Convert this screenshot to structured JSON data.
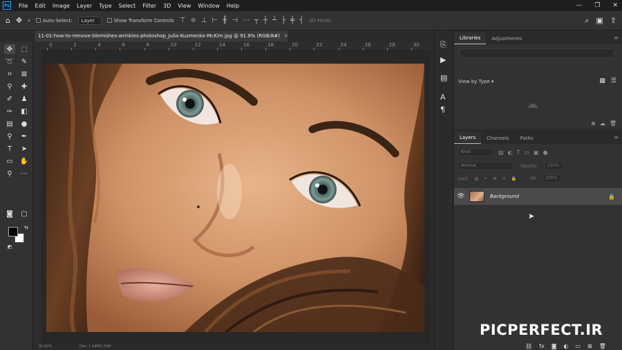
{
  "app": {
    "logo": "Ps"
  },
  "menu": [
    "File",
    "Edit",
    "Image",
    "Layer",
    "Type",
    "Select",
    "Filter",
    "3D",
    "View",
    "Window",
    "Help"
  ],
  "window_controls": [
    "—",
    "❐",
    "✕"
  ],
  "options_bar": {
    "auto_select_label": "Auto-Select:",
    "layer_select_value": "Layer",
    "show_transform_label": "Show Transform Controls",
    "mode_3d_label": "3D Mode:"
  },
  "document": {
    "tab_title": "11-01-how-to-remove-blemishes-wrinkles-photoshop_Julia-Kuzmenko-McKim.jpg @ 91.9% (RGB/8#)",
    "ruler_numbers": [
      "0",
      "2",
      "4",
      "6",
      "8",
      "10",
      "12",
      "14",
      "16",
      "18",
      "20",
      "22",
      "24",
      "26",
      "28",
      "30"
    ],
    "status_zoom": "91.92%",
    "status_doc": "Doc: 1.34M/1.34M"
  },
  "libraries_panel": {
    "tabs": [
      "Libraries",
      "Adjustments"
    ],
    "view_by_label": "View by Type"
  },
  "layers_panel": {
    "tabs": [
      "Layers",
      "Channels",
      "Paths"
    ],
    "kind_placeholder": "Kind",
    "blend_mode": "Normal",
    "opacity_label": "Opacity:",
    "opacity_value": "100%",
    "lock_label": "Lock:",
    "fill_label": "Fill:",
    "fill_value": "100%",
    "layers": [
      {
        "name": "Background",
        "visible": true,
        "locked": true
      }
    ]
  },
  "watermark": "PICPERFECT.IR",
  "colors": {
    "accent": "#31a8ff",
    "panel": "#323232",
    "menubar": "#1e1e1e",
    "foreground": "#000000",
    "background": "#ffffff"
  }
}
